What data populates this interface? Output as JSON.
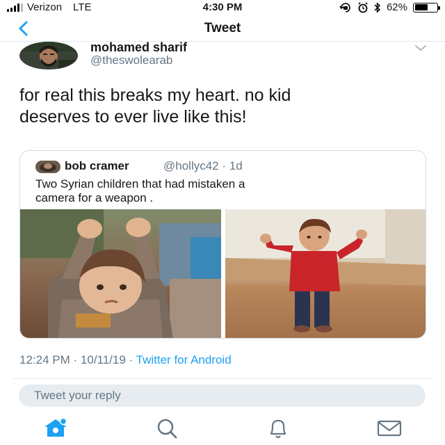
{
  "status_bar": {
    "carrier": "Verizon",
    "network": "LTE",
    "time": "4:30 PM",
    "battery": "62%",
    "battery_level": 0.62,
    "icons": [
      "signal-icon",
      "lock-rotation-icon",
      "alarm-icon",
      "bluetooth-icon",
      "battery-icon"
    ]
  },
  "nav": {
    "title": "Tweet",
    "back_icon": "chevron-left-icon"
  },
  "tweet": {
    "author_name": "mohamed sharif",
    "author_handle": "@theswolearab",
    "text_line1": "for real this breaks my heart. no kid",
    "text_line2": "deserves to ever live like this!",
    "time": "12:24 PM",
    "separator": "·",
    "date": "10/11/19",
    "source": "Twitter for Android"
  },
  "quoted_tweet": {
    "author_name": "bob cramer",
    "author_handle": "@hollyc42",
    "separator": "·",
    "age": "1d",
    "text_line1": "Two Syrian children that had mistaken a",
    "text_line2": "camera for a weapon ."
  },
  "reply": {
    "placeholder": "Tweet your reply"
  },
  "tabs": [
    "home-icon",
    "search-icon",
    "notifications-icon",
    "messages-icon"
  ],
  "colors": {
    "accent": "#1da1f2",
    "secondary_text": "#657786",
    "reply_bg": "#e6ecf0"
  }
}
